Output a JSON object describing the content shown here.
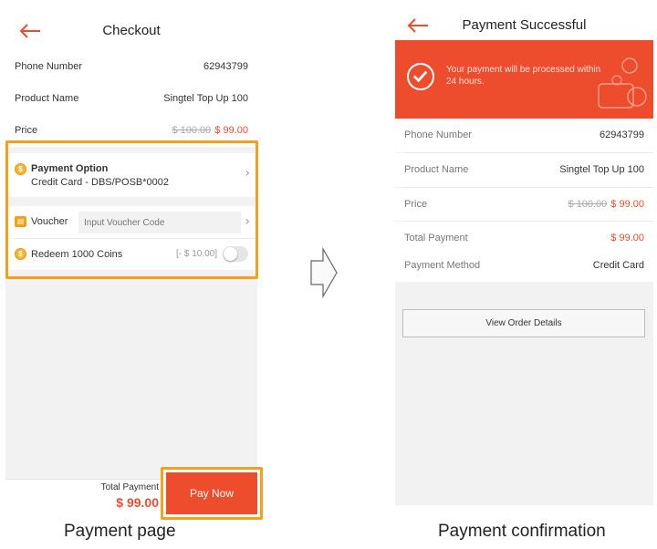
{
  "payment_page": {
    "title": "Checkout",
    "rows": {
      "phone": {
        "label": "Phone Number",
        "value": "62943799"
      },
      "product": {
        "label": "Product Name",
        "value": "Singtel Top Up 100"
      },
      "price": {
        "label": "Price",
        "old": "$ 100.00",
        "new": "$ 99.00"
      }
    },
    "payment_option": {
      "label": "Payment Option",
      "value": "Credit Card - DBS/POSB*0002"
    },
    "voucher": {
      "label": "Voucher",
      "placeholder": "Input Voucher Code"
    },
    "coins": {
      "label": "Redeem 1000 Coins",
      "amount": "[- $ 10.00]",
      "enabled": false
    },
    "total": {
      "label": "Total Payment",
      "value": "$ 99.00"
    },
    "pay_button": "Pay Now",
    "caption": "Payment page"
  },
  "confirmation_page": {
    "title": "Payment Successful",
    "banner": "Your payment will be processed within 24 hours.",
    "rows": {
      "phone": {
        "label": "Phone Number",
        "value": "62943799"
      },
      "product": {
        "label": "Product Name",
        "value": "Singtel Top Up 100"
      },
      "price": {
        "label": "Price",
        "old": "$ 100.00",
        "new": "$ 99.00"
      },
      "total": {
        "label": "Total Payment",
        "value": "$ 99.00"
      },
      "method": {
        "label": "Payment Method",
        "value": "Credit Card"
      }
    },
    "view_button": "View Order Details",
    "caption": "Payment confirmation"
  },
  "colors": {
    "accent": "#ee4d2d",
    "highlight": "#f5a01a"
  },
  "icons": [
    "back-arrow-icon",
    "coin-icon",
    "voucher-icon",
    "chevron-right-icon",
    "check-circle-icon",
    "flow-arrow-icon"
  ]
}
